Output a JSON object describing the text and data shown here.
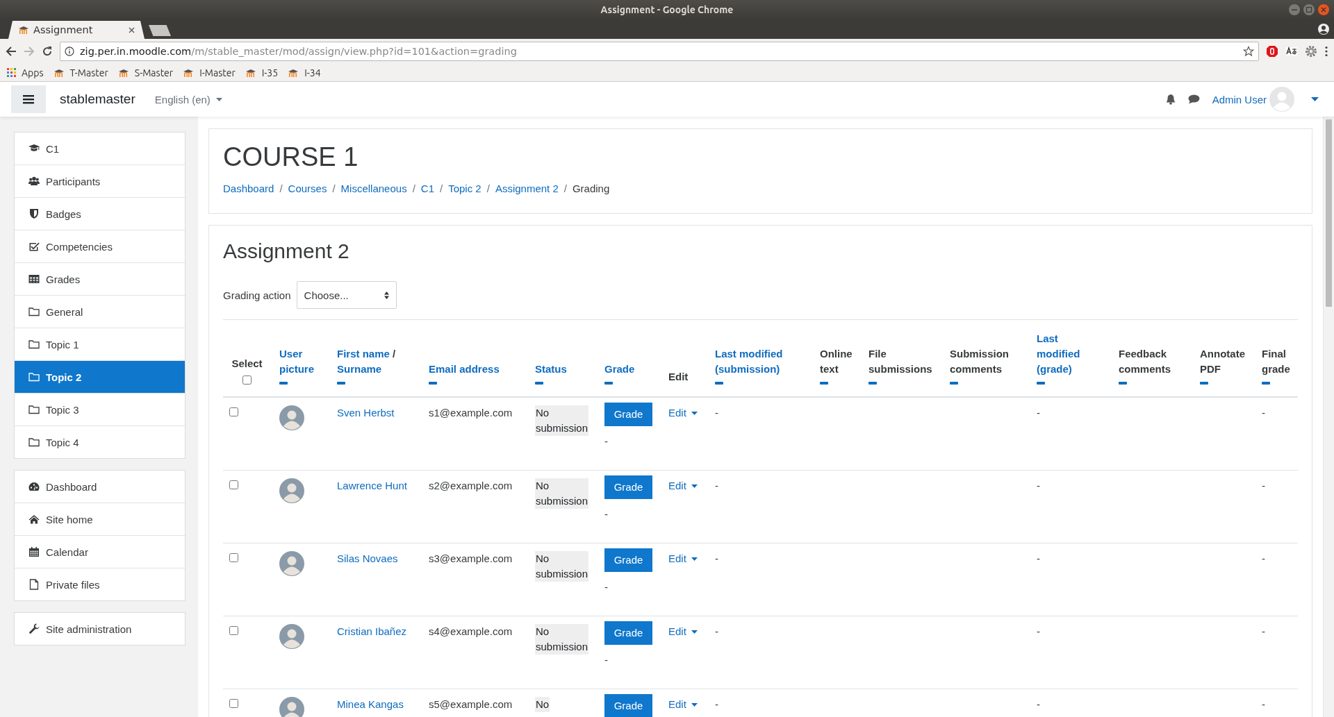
{
  "window": {
    "title": "Assignment - Google Chrome"
  },
  "browser": {
    "tab": {
      "title": "Assignment"
    },
    "url": {
      "host": "zig.per.in.moodle.com",
      "path": "/m/stable_master/mod/assign/view.php?id=101&action=grading"
    },
    "bookmarks": [
      {
        "kind": "apps",
        "label": "Apps"
      },
      {
        "kind": "site",
        "label": "T-Master"
      },
      {
        "kind": "site",
        "label": "S-Master"
      },
      {
        "kind": "site",
        "label": "I-Master"
      },
      {
        "kind": "site",
        "label": "I-35"
      },
      {
        "kind": "site",
        "label": "I-34"
      }
    ]
  },
  "navbar": {
    "site_name": "stablemaster",
    "language": "English (en)",
    "user": "Admin User"
  },
  "sidebar": {
    "groups": [
      [
        {
          "kind": "course",
          "label": "C1",
          "selected": false
        },
        {
          "kind": "participants",
          "label": "Participants",
          "selected": false
        },
        {
          "kind": "badges",
          "label": "Badges",
          "selected": false
        },
        {
          "kind": "competencies",
          "label": "Competencies",
          "selected": false
        },
        {
          "kind": "grades",
          "label": "Grades",
          "selected": false
        },
        {
          "kind": "section",
          "label": "General",
          "selected": false
        },
        {
          "kind": "section",
          "label": "Topic 1",
          "selected": false
        },
        {
          "kind": "section",
          "label": "Topic 2",
          "selected": true
        },
        {
          "kind": "section",
          "label": "Topic 3",
          "selected": false
        },
        {
          "kind": "section",
          "label": "Topic 4",
          "selected": false
        }
      ],
      [
        {
          "kind": "dashboard",
          "label": "Dashboard",
          "selected": false
        },
        {
          "kind": "home",
          "label": "Site home",
          "selected": false
        },
        {
          "kind": "calendar",
          "label": "Calendar",
          "selected": false
        },
        {
          "kind": "files",
          "label": "Private files",
          "selected": false
        }
      ],
      [
        {
          "kind": "admin",
          "label": "Site administration",
          "selected": false
        }
      ]
    ]
  },
  "header": {
    "title": "COURSE 1",
    "separator": "/",
    "breadcrumb": [
      {
        "label": "Dashboard",
        "link": true
      },
      {
        "label": "Courses",
        "link": true
      },
      {
        "label": "Miscellaneous",
        "link": true
      },
      {
        "label": "C1",
        "link": true
      },
      {
        "label": "Topic 2",
        "link": true
      },
      {
        "label": "Assignment 2",
        "link": true
      },
      {
        "label": "Grading",
        "link": false
      }
    ]
  },
  "assignment": {
    "title": "Assignment 2",
    "grading_action": {
      "label": "Grading action",
      "value": "Choose..."
    },
    "table": {
      "columns": [
        {
          "kind": "select",
          "label": "Select",
          "collapsible": false,
          "checked": false
        },
        {
          "kind": "link",
          "label": "User picture",
          "collapsible": true
        },
        {
          "kind": "pair",
          "labels": [
            "First name",
            "Surname"
          ],
          "separator": "/",
          "collapsible": true
        },
        {
          "kind": "link",
          "label": "Email address",
          "collapsible": true
        },
        {
          "kind": "link",
          "label": "Status",
          "collapsible": true
        },
        {
          "kind": "link",
          "label": "Grade",
          "collapsible": true
        },
        {
          "kind": "text",
          "label": "Edit",
          "collapsible": false
        },
        {
          "kind": "link",
          "label": "Last modified (submission)",
          "collapsible": true
        },
        {
          "kind": "text",
          "label": "Online text",
          "collapsible": true
        },
        {
          "kind": "text",
          "label": "File submissions",
          "collapsible": true
        },
        {
          "kind": "text",
          "label": "Submission comments",
          "collapsible": true
        },
        {
          "kind": "link",
          "label": "Last modified (grade)",
          "collapsible": true
        },
        {
          "kind": "text",
          "label": "Feedback comments",
          "collapsible": true
        },
        {
          "kind": "text",
          "label": "Annotate PDF",
          "collapsible": true
        },
        {
          "kind": "text",
          "label": "Final grade",
          "collapsible": true
        }
      ],
      "rows": [
        {
          "selected": false,
          "name": "Sven Herbst",
          "email": "s1@example.com",
          "status": "No submission",
          "grade_button": "Grade",
          "grade": "-",
          "edit": "Edit",
          "last_modified_submission": "-",
          "last_modified_grade": "-",
          "final_grade": "-"
        },
        {
          "selected": false,
          "name": "Lawrence Hunt",
          "email": "s2@example.com",
          "status": "No submission",
          "grade_button": "Grade",
          "grade": "-",
          "edit": "Edit",
          "last_modified_submission": "-",
          "last_modified_grade": "-",
          "final_grade": "-"
        },
        {
          "selected": false,
          "name": "Silas Novaes",
          "email": "s3@example.com",
          "status": "No submission",
          "grade_button": "Grade",
          "grade": "-",
          "edit": "Edit",
          "last_modified_submission": "-",
          "last_modified_grade": "-",
          "final_grade": "-"
        },
        {
          "selected": false,
          "name": "Cristian Ibañez",
          "email": "s4@example.com",
          "status": "No submission",
          "grade_button": "Grade",
          "grade": "-",
          "edit": "Edit",
          "last_modified_submission": "-",
          "last_modified_grade": "-",
          "final_grade": "-"
        },
        {
          "selected": false,
          "name": "Minea Kangas",
          "email": "s5@example.com",
          "status": "No",
          "grade_button": "Grade",
          "edit": "Edit",
          "last_modified_submission": "-",
          "last_modified_grade": "-",
          "final_grade": "-"
        }
      ]
    }
  }
}
